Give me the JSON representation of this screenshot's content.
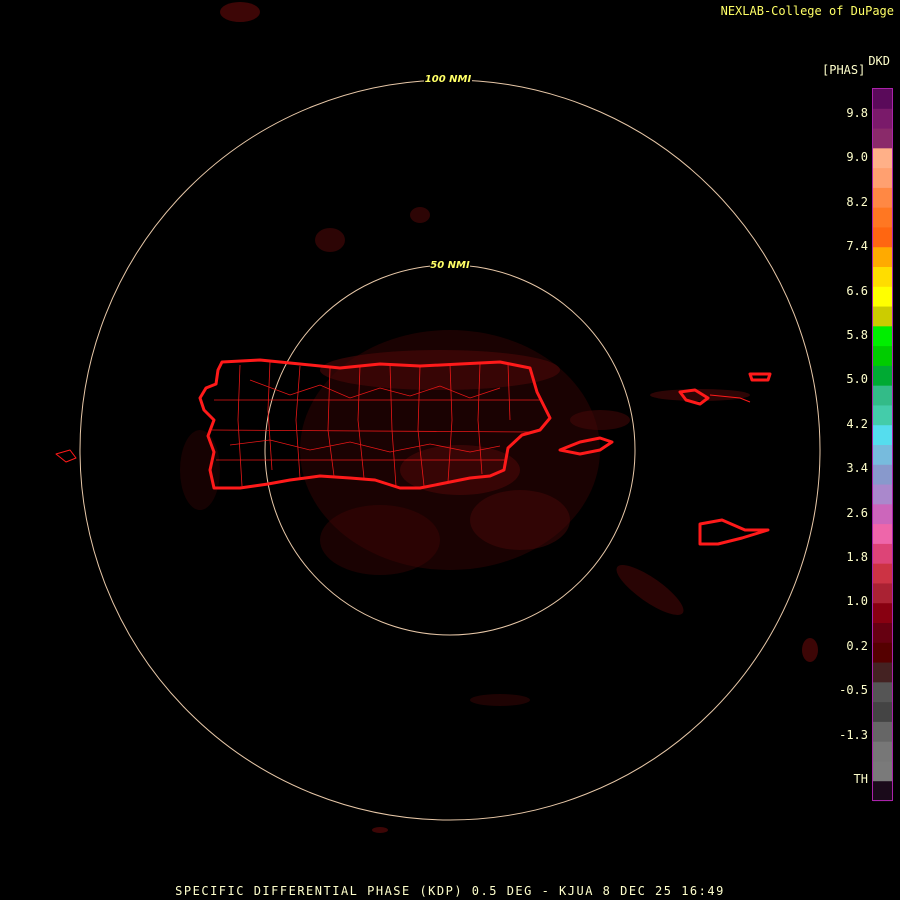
{
  "header": {
    "credit": "NEXLAB-College of DuPage",
    "units_code": "DKD",
    "units_label": "[PHAS]"
  },
  "footer": {
    "caption": "SPECIFIC DIFFERENTIAL PHASE (KDP) 0.5 DEG - KJUA 8 DEC 25 16:49"
  },
  "range_rings": [
    {
      "label": "100 NMI"
    },
    {
      "label": "50 NMI"
    }
  ],
  "colorbar": {
    "labels": [
      "9.8",
      "9.0",
      "8.2",
      "7.4",
      "6.6",
      "5.8",
      "5.0",
      "4.2",
      "3.4",
      "2.6",
      "1.8",
      "1.0",
      "0.2",
      "-0.5",
      "-1.3",
      "TH"
    ],
    "colors": [
      "#5a0a5a",
      "#7a1a6a",
      "#8a2a6a",
      "#ffb088",
      "#ffa070",
      "#ff8844",
      "#ff7722",
      "#ff6611",
      "#ffaa00",
      "#ffdd00",
      "#ffff00",
      "#cccc00",
      "#00ee00",
      "#00cc00",
      "#00aa33",
      "#33bb88",
      "#44ccaa",
      "#55ddee",
      "#77bbdd",
      "#8899cc",
      "#aa88cc",
      "#cc66bb",
      "#ee66aa",
      "#dd4477",
      "#cc3344",
      "#aa2233",
      "#880011",
      "#660011",
      "#550000",
      "#442222",
      "#555555",
      "#444444",
      "#666666",
      "#777777",
      "#7a7a7a",
      "#1a0a1a"
    ]
  },
  "colors": {
    "ring": "#e8c8a8",
    "coast": "#ff1a1a",
    "echo": "#5a0a0a",
    "text": "#ffff66"
  }
}
